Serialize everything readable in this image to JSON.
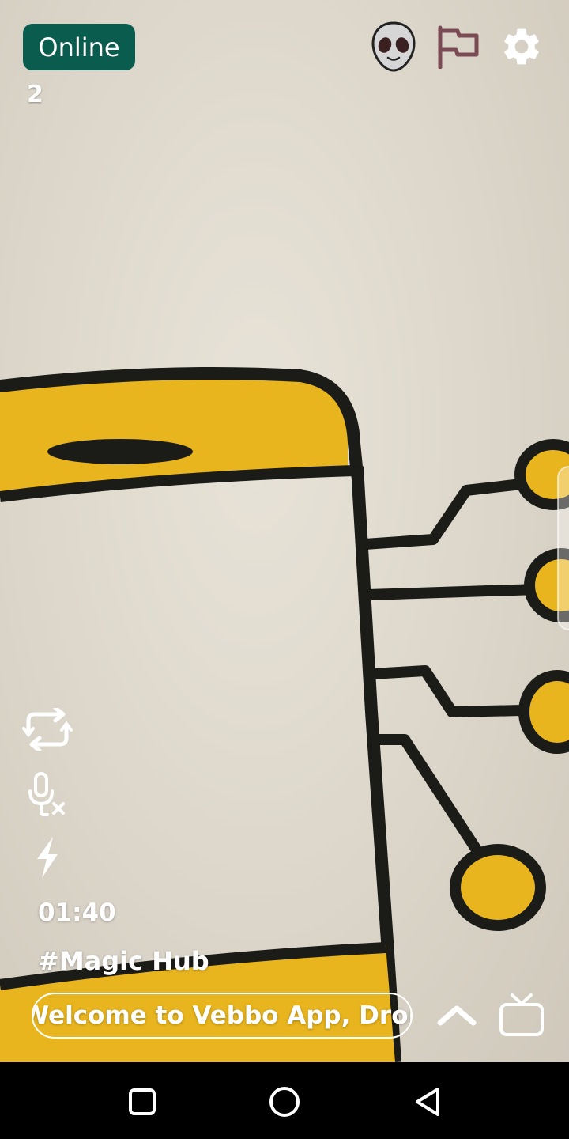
{
  "status": {
    "online_label": "Online",
    "online_count": "2"
  },
  "top_icons": [
    "alien-avatar-icon",
    "flag-icon",
    "gear-icon"
  ],
  "side_controls": [
    "switch-camera-icon",
    "mic-muted-icon",
    "flash-icon"
  ],
  "timer": "01:40",
  "room": {
    "tag": "#Magic Hub"
  },
  "marquee": {
    "text": "Welcome to Vebbo App, Drop"
  },
  "bottom_icons": [
    "chevron-up-icon",
    "tv-icon"
  ],
  "navbar": [
    "recents-square-icon",
    "home-circle-icon",
    "back-triangle-icon"
  ],
  "colors": {
    "online_badge": "#0a5c4e",
    "flag": "#7a4a55",
    "drawing_yellow": "#e8b51e",
    "drawing_ink": "#1b1b17"
  }
}
